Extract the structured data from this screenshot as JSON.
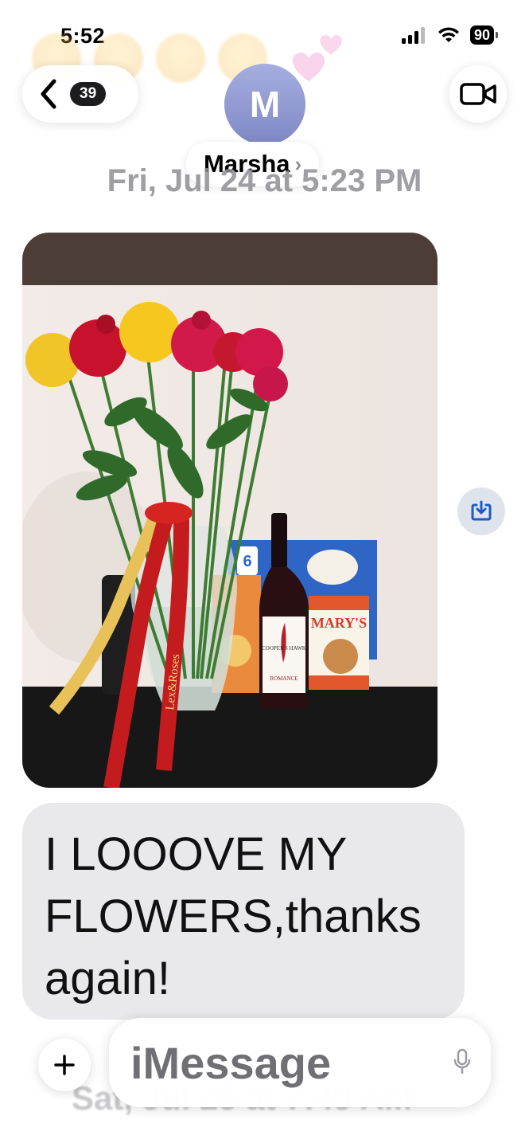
{
  "status_bar": {
    "time": "5:52",
    "battery": "90"
  },
  "header": {
    "back_badge_count": "39",
    "contact_initial": "M",
    "contact_name": "Marsha",
    "contact_chevron": "›"
  },
  "thread": {
    "date_label": "Fri, Jul 24 at 5:23 PM",
    "message_text": "I LOOOVE MY FLOWERS,thanks again!",
    "next_date_label": "Sat, Jul 25 at 7:49 AM"
  },
  "photo": {
    "ribbon_text": "Lex&Roses",
    "wine_brand": "COOPER'S HAWK",
    "wine_name": "ROMANCE",
    "cracker_brand": "MARY'S",
    "popcorn_bag_count": "6"
  },
  "composer": {
    "placeholder": "iMessage"
  },
  "icons": {
    "back": "chevron-left-icon",
    "video": "video-camera-icon",
    "save": "save-image-icon",
    "plus": "plus-icon",
    "mic": "microphone-icon"
  },
  "colors": {
    "incoming_bubble": "#e9e9eb",
    "avatar": "#8f97d0",
    "badge": "#1c1c1e"
  }
}
